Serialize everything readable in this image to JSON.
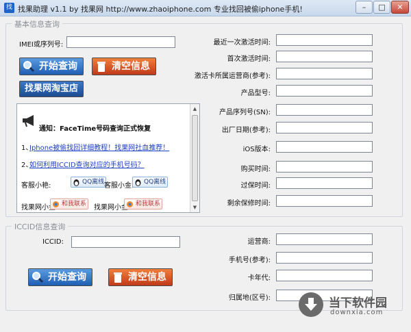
{
  "window": {
    "title": "找果助理  v1.1     by 找果网  http://www.zhaoiphone.com  专业找回被偷iphone手机!",
    "icon_text": "找",
    "min_glyph": "–",
    "max_glyph": "□",
    "close_glyph": "✕"
  },
  "basic": {
    "legend": "基本信息查询",
    "imei_label": "IMEI或序列号:",
    "imei_value": "",
    "start_button": "开始查询",
    "clear_button": "清空信息",
    "taobao_button": "找果网淘宝店",
    "fields": [
      {
        "label": "最近一次激活时间:",
        "value": ""
      },
      {
        "label": "首次激活时间:",
        "value": ""
      },
      {
        "label": "激活卡所属运营商(参考):",
        "value": ""
      },
      {
        "label": "产品型号:",
        "value": ""
      },
      {
        "label": "产品序列号(SN):",
        "value": ""
      },
      {
        "label": "出厂日期(参考):",
        "value": ""
      },
      {
        "label": "iOS版本:",
        "value": ""
      },
      {
        "label": "购买时间:",
        "value": ""
      },
      {
        "label": "过保时间:",
        "value": ""
      },
      {
        "label": "剩余保修时间:",
        "value": ""
      }
    ]
  },
  "notice": {
    "title": "通知：FaceTime号码查询正式恢复",
    "link1_prefix": "1、",
    "link1": "Iphone被偷找回详细教程！找果网社血推荐！",
    "link2_prefix": "2、",
    "link2": "如何利用ICCID查询对应的手机号码？",
    "service1_label": "客服小艳:",
    "service2_label": "客服小金:",
    "qq_badge": "QQ离线",
    "shop1_label": "找果网小金:",
    "shop2_label": "找果网小金:",
    "contact_badge": "和我联系"
  },
  "iccid": {
    "legend": "ICCID信息查询",
    "iccid_label": "ICCID:",
    "iccid_value": "",
    "start_button": "开始查询",
    "clear_button": "清空信息",
    "fields": [
      {
        "label": "运营商:",
        "value": ""
      },
      {
        "label": "手机号(参考):",
        "value": ""
      },
      {
        "label": "卡年代:",
        "value": ""
      },
      {
        "label": "归属地(区号):",
        "value": ""
      }
    ]
  },
  "watermark": {
    "title": "当下软件园",
    "url": "downxia.com"
  }
}
